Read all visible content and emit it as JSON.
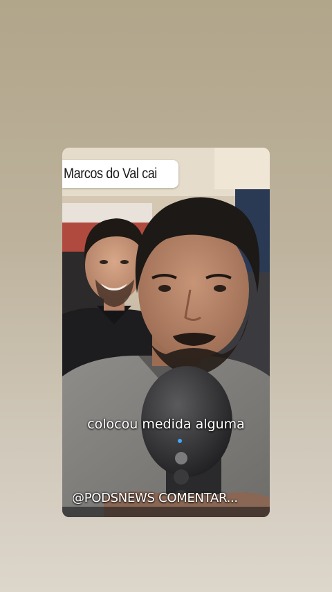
{
  "story": {
    "title": "Marcos do Val cai",
    "caption": "colocou medida alguma",
    "handle": "@PODSNEWS COMENTAR..."
  },
  "scene": {
    "subjects": [
      "man-in-background",
      "man-speaking-at-microphone"
    ],
    "icons": [
      "microphone-icon"
    ]
  },
  "colors": {
    "page_background_top": "#b1a58a",
    "page_background_bottom": "#ddd6cb",
    "banner_background": "#ffffff",
    "caption_text": "#ffffff"
  }
}
